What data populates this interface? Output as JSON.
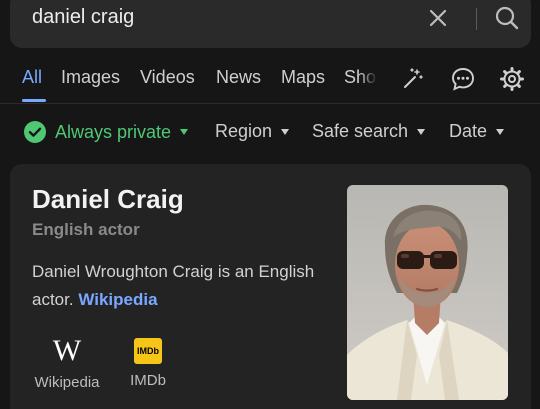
{
  "search": {
    "query": "daniel craig"
  },
  "tabs": [
    {
      "label": "All",
      "active": true
    },
    {
      "label": "Images"
    },
    {
      "label": "Videos"
    },
    {
      "label": "News"
    },
    {
      "label": "Maps"
    },
    {
      "label": "Shopping"
    }
  ],
  "tab_icons": [
    "magic-wand-icon",
    "chat-icon",
    "settings-icon"
  ],
  "filters": {
    "private": "Always private",
    "region": "Region",
    "safe_search": "Safe search",
    "date": "Date"
  },
  "knowledge_panel": {
    "title": "Daniel Craig",
    "subtitle": "English actor",
    "description": "Daniel Wroughton Craig is an English actor.",
    "description_link": "Wikipedia",
    "links": [
      {
        "label": "Wikipedia",
        "icon": "wikipedia-icon"
      },
      {
        "label": "IMDb",
        "icon": "imdb-icon",
        "logo_text": "IMDb"
      }
    ]
  },
  "colors": {
    "accent": "#7aa7ff",
    "private_green": "#4fc774",
    "imdb_yellow": "#f5c518",
    "background": "#161617",
    "card": "#232324"
  }
}
